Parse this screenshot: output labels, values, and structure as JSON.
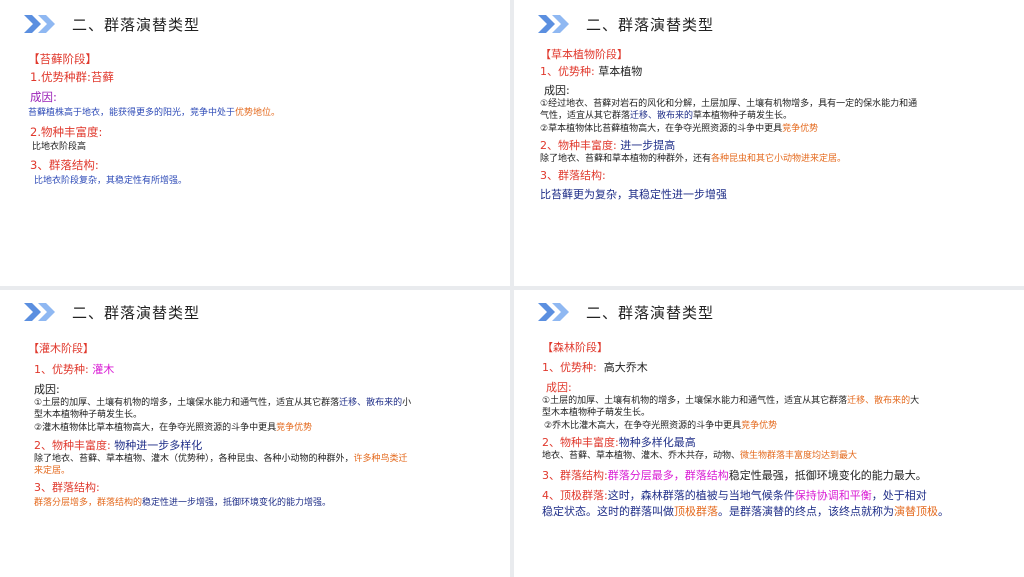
{
  "header_title": "二、群落演替类型",
  "moss": {
    "stage": "【苔藓阶段】",
    "dom_label": "1.优势种群:",
    "dom_value": "苔藓",
    "cause_label": "成因:",
    "cause_a": "苔藓植株高于地衣，",
    "cause_b": "能获得更多的阳光，",
    "cause_c": "竞争中处于",
    "cause_d": "优势地位。",
    "rich_label": "2.物种丰富度:",
    "rich_value": "比地衣阶段高",
    "struct_label": "3、群落结构:",
    "struct_value": "比地衣阶段复杂，其稳定性有所增强。"
  },
  "herb": {
    "stage": "【草本植物阶段】",
    "dom_label": "1、优势种:",
    "dom_value": "草本植物",
    "cause_label": "成因:",
    "c1_a": "①经过地衣、苔藓对岩石的风化和分解，土层加厚、土壤有机物增多，具有一定的保水能力和通",
    "c1_b": "气性，适宜从其它群落",
    "c1_c": "迁移、散布来的",
    "c1_d": "草本植物种子萌发生长。",
    "c2_a": "②草本植物体比苔藓植物高大，在争夺光照资源的斗争中更具",
    "c2_b": "竞争优势",
    "rich_label": "2、物种丰富度:",
    "rich_value": "进一步提高",
    "rich_desc_a": "除了地衣、苔藓和草本植物的种群外，还有",
    "rich_desc_b": "各种昆虫和其它小动物进来定居。",
    "struct_label": "3、群落结构:",
    "struct_value": "比苔藓更为复杂，其稳定性进一步增强"
  },
  "shrub": {
    "stage": "【灌木阶段】",
    "dom_label": "1、优势种:",
    "dom_value": "灌木",
    "cause_label": "成因:",
    "c1_a": "①土层的加厚、土壤有机物的增多，土壤保水能力和通气性，适宜从其它群落",
    "c1_b": "迁移、散布来的",
    "c1_c": "小",
    "c1_d": "型木本植物种子萌发生长。",
    "c2_a": "②灌木植物体比草本植物高大，在争夺光照资源的斗争中更具",
    "c2_b": "竞争优势",
    "rich_label": "2、物种丰富度:",
    "rich_value": "物种进一步多样化",
    "rich_desc_a": "除了地衣、苔藓、草本植物、灌木（优势种），各种昆虫、各种小动物的种群外，",
    "rich_desc_b": "许多种鸟类迁",
    "rich_desc_c": "来定居。",
    "struct_label": "3、群落结构:",
    "struct_a": "群落分层增多，群落结构的",
    "struct_b": "稳定性进一步增强，抵御环境变化的能力增强。"
  },
  "forest": {
    "stage": "【森林阶段】",
    "dom_label": "1、优势种:",
    "dom_value": "高大乔木",
    "cause_label": "成因:",
    "c1_a": "①土层的加厚、土壤有机物的增多，土壤保水能力和通气性，适宜从其它群落",
    "c1_b": "迁移、散布来的",
    "c1_c": "大",
    "c1_d": "型木本植物种子萌发生长。",
    "c2_a": "②乔木比灌木高大，在争夺光照资源的斗争中更具",
    "c2_b": "竞争优势",
    "rich_label": "2、物种丰富度:",
    "rich_value": "物种多样化最高",
    "rich_desc_a": "地衣、苔藓、草本植物、灌木、乔木共存，动物、",
    "rich_desc_b": "微生物群落丰富度均达到最大",
    "struct_label": "3、群落结构:",
    "struct_a": "群落分层最多，群落结构",
    "struct_b": "稳定性最强，抵御环境变化的能力最大。",
    "climax_label": "4、顶极群落:",
    "climax_a": "这时，森林群落的植被与当地气候条件",
    "climax_b": "保持协调和平衡",
    "climax_c": "，处于相对",
    "climax_d": "稳定状态。这时的群落叫做",
    "climax_e": "顶极群落",
    "climax_f": "。是群落演替的终点，该终点就称为",
    "climax_g": "演替顶极",
    "climax_h": "。"
  }
}
